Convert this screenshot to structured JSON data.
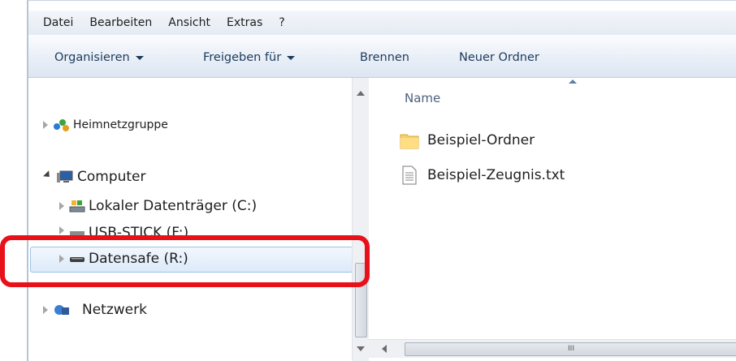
{
  "menu": {
    "items": [
      "Datei",
      "Bearbeiten",
      "Ansicht",
      "Extras",
      "?"
    ]
  },
  "toolbar": {
    "organize": "Organisieren",
    "share": "Freigeben für",
    "burn": "Brennen",
    "new_folder": "Neuer Ordner"
  },
  "nav": {
    "homegroup": "Heimnetzgruppe",
    "computer": "Computer",
    "local_disk": "Lokaler Datenträger (C:)",
    "usb": "USB-STICK (F:)",
    "datasafe": "Datensafe (R:)",
    "network": "Netzwerk"
  },
  "content": {
    "column_name": "Name",
    "files": [
      {
        "name": "Beispiel-Ordner",
        "icon": "folder-icon"
      },
      {
        "name": "Beispiel-Zeugnis.txt",
        "icon": "text-file-icon"
      }
    ]
  },
  "scrollbar": {
    "grip": "III"
  },
  "colors": {
    "highlight": "#e8111a",
    "selection": "#dceaf9",
    "toolbar_text": "#1d3a5c"
  }
}
